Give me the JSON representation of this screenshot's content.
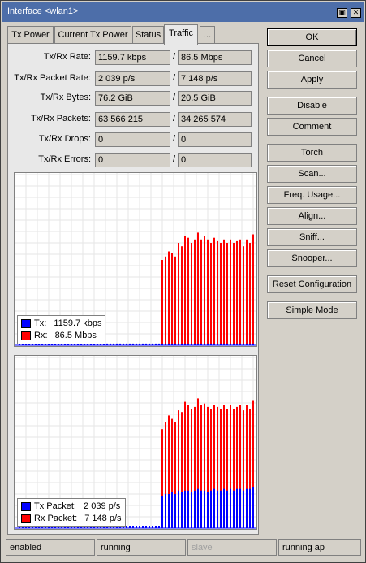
{
  "window": {
    "title": "Interface <wlan1>",
    "minimize_glyph": "▣",
    "close_glyph": "✕"
  },
  "tabs": [
    {
      "label": "Tx Power"
    },
    {
      "label": "Current Tx Power"
    },
    {
      "label": "Status"
    },
    {
      "label": "Traffic",
      "active": true
    },
    {
      "label": "..."
    }
  ],
  "stats": [
    {
      "label": "Tx/Rx Rate:",
      "tx": "1159.7 kbps",
      "rx": "86.5 Mbps"
    },
    {
      "label": "Tx/Rx Packet Rate:",
      "tx": "2 039 p/s",
      "rx": "7 148 p/s"
    },
    {
      "label": "Tx/Rx Bytes:",
      "tx": "76.2 GiB",
      "rx": "20.5 GiB"
    },
    {
      "label": "Tx/Rx Packets:",
      "tx": "63 566 215",
      "rx": "34 265 574"
    },
    {
      "label": "Tx/Rx Drops:",
      "tx": "0",
      "rx": "0"
    },
    {
      "label": "Tx/Rx Errors:",
      "tx": "0",
      "rx": "0"
    }
  ],
  "separator": "/",
  "colors": {
    "tx": "#0000ff",
    "rx": "#ff0000"
  },
  "chart_data": [
    {
      "type": "bar",
      "legend_position": "bottom-left",
      "grid": true,
      "ylim": [
        0,
        1
      ],
      "series": [
        {
          "name": "Tx:",
          "value_label": "1159.7 kbps",
          "color": "#0000ff",
          "values": [
            0.01,
            0.01,
            0.01,
            0.01,
            0.01,
            0.01,
            0.01,
            0.01,
            0.01,
            0.01,
            0.01,
            0.01,
            0.01,
            0.01,
            0.01,
            0.01,
            0.01,
            0.01,
            0.01,
            0.01,
            0.01,
            0.01,
            0.01,
            0.01,
            0.01,
            0.01,
            0.01,
            0.01,
            0.01,
            0.01,
            0.01,
            0.01,
            0.01,
            0.01,
            0.01,
            0.01,
            0.01,
            0.01,
            0.01,
            0.01,
            0.01,
            0.01,
            0.01,
            0.01,
            0.01,
            0.01,
            0.01,
            0.01,
            0.01,
            0.01,
            0.01,
            0.01,
            0.01,
            0.01,
            0.01,
            0.01,
            0.01,
            0.01,
            0.01,
            0.01,
            0.01,
            0.01,
            0.01,
            0.01,
            0.01,
            0.01,
            0.01,
            0.01,
            0.01,
            0.01,
            0.01,
            0.01,
            0.01,
            0.01
          ]
        },
        {
          "name": "Rx:",
          "value_label": "86.5 Mbps",
          "color": "#ff0000",
          "values": [
            0,
            0,
            0,
            0,
            0,
            0,
            0,
            0,
            0,
            0,
            0,
            0,
            0,
            0,
            0,
            0,
            0,
            0,
            0,
            0,
            0,
            0,
            0,
            0,
            0,
            0,
            0,
            0,
            0,
            0,
            0,
            0,
            0,
            0,
            0,
            0,
            0,
            0,
            0,
            0,
            0,
            0,
            0,
            0,
            0.5,
            0.52,
            0.55,
            0.54,
            0.52,
            0.6,
            0.58,
            0.64,
            0.63,
            0.6,
            0.62,
            0.66,
            0.62,
            0.64,
            0.62,
            0.6,
            0.63,
            0.61,
            0.6,
            0.62,
            0.6,
            0.62,
            0.6,
            0.61,
            0.62,
            0.58,
            0.62,
            0.6,
            0.65,
            0.62
          ]
        }
      ]
    },
    {
      "type": "bar",
      "legend_position": "bottom-left",
      "grid": true,
      "ylim": [
        0,
        1
      ],
      "series": [
        {
          "name": "Tx Packet:",
          "value_label": "2 039 p/s",
          "color": "#0000ff",
          "values": [
            0.01,
            0.01,
            0.01,
            0.01,
            0.01,
            0.01,
            0.01,
            0.01,
            0.01,
            0.01,
            0.01,
            0.01,
            0.01,
            0.01,
            0.01,
            0.01,
            0.01,
            0.01,
            0.01,
            0.01,
            0.01,
            0.01,
            0.01,
            0.01,
            0.01,
            0.01,
            0.01,
            0.01,
            0.01,
            0.01,
            0.01,
            0.01,
            0.01,
            0.01,
            0.01,
            0.01,
            0.01,
            0.01,
            0.01,
            0.01,
            0.01,
            0.01,
            0.01,
            0.01,
            0.19,
            0.2,
            0.2,
            0.21,
            0.2,
            0.22,
            0.21,
            0.22,
            0.22,
            0.21,
            0.22,
            0.23,
            0.22,
            0.22,
            0.21,
            0.22,
            0.23,
            0.22,
            0.22,
            0.23,
            0.22,
            0.23,
            0.22,
            0.23,
            0.23,
            0.22,
            0.23,
            0.23,
            0.24,
            0.24
          ]
        },
        {
          "name": "Rx Packet:",
          "value_label": "7 148 p/s",
          "color": "#ff0000",
          "values": [
            0,
            0,
            0,
            0,
            0,
            0,
            0,
            0,
            0,
            0,
            0,
            0,
            0,
            0,
            0,
            0,
            0,
            0,
            0,
            0,
            0,
            0,
            0,
            0,
            0,
            0,
            0,
            0,
            0,
            0,
            0,
            0,
            0,
            0,
            0,
            0,
            0,
            0,
            0,
            0,
            0,
            0,
            0,
            0,
            0.58,
            0.62,
            0.66,
            0.64,
            0.62,
            0.69,
            0.68,
            0.74,
            0.72,
            0.7,
            0.71,
            0.76,
            0.72,
            0.73,
            0.71,
            0.7,
            0.72,
            0.71,
            0.7,
            0.72,
            0.7,
            0.72,
            0.7,
            0.71,
            0.72,
            0.69,
            0.72,
            0.7,
            0.75,
            0.72
          ]
        }
      ]
    }
  ],
  "buttons": [
    {
      "label": "OK",
      "name": "ok-button",
      "default": true
    },
    {
      "label": "Cancel",
      "name": "cancel-button"
    },
    {
      "label": "Apply",
      "name": "apply-button"
    },
    {
      "label": "Disable",
      "name": "disable-button"
    },
    {
      "label": "Comment",
      "name": "comment-button"
    },
    {
      "label": "Torch",
      "name": "torch-button"
    },
    {
      "label": "Scan...",
      "name": "scan-button"
    },
    {
      "label": "Freq. Usage...",
      "name": "freq-usage-button"
    },
    {
      "label": "Align...",
      "name": "align-button"
    },
    {
      "label": "Sniff...",
      "name": "sniff-button"
    },
    {
      "label": "Snooper...",
      "name": "snooper-button"
    },
    {
      "label": "Reset Configuration",
      "name": "reset-configuration-button"
    },
    {
      "label": "Simple Mode",
      "name": "simple-mode-button"
    }
  ],
  "status": [
    {
      "text": "enabled"
    },
    {
      "text": "running"
    },
    {
      "text": "slave",
      "dim": true
    },
    {
      "text": "running ap"
    }
  ]
}
